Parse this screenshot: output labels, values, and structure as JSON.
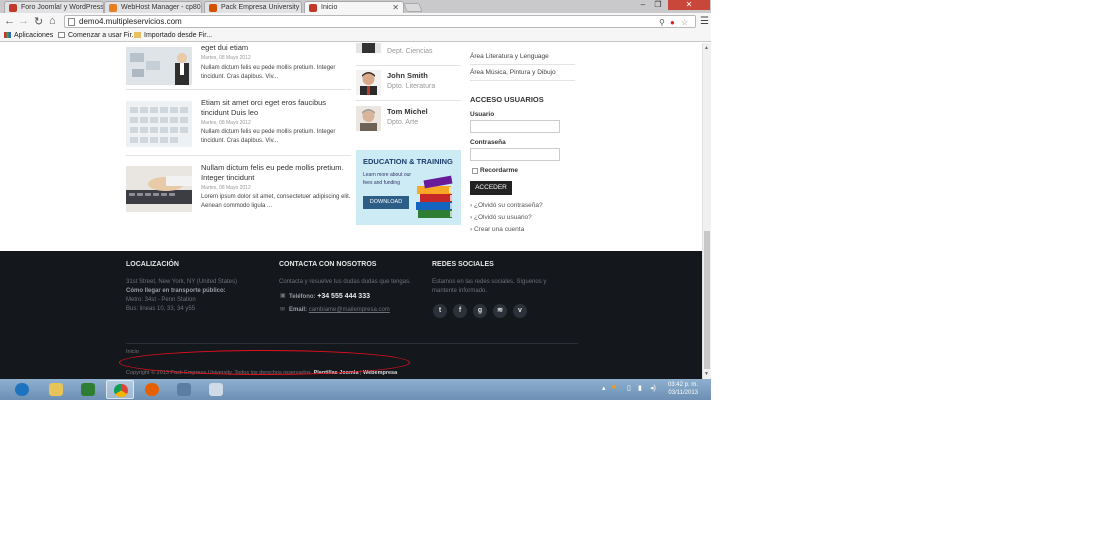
{
  "browser": {
    "tabs": [
      {
        "label": "Foro Joomla! y WordPress",
        "favicon_color": "#c0392b",
        "active": false
      },
      {
        "label": "WebHost Manager - cp80",
        "favicon_color": "#e67e22",
        "active": false
      },
      {
        "label": "Pack Empresa University",
        "favicon_color": "#d35400",
        "active": false
      },
      {
        "label": "Inicio",
        "favicon_color": "#c0392b",
        "active": true
      }
    ],
    "url": "demo4.multipleservicios.com",
    "bookmarks": [
      {
        "label": "Aplicaciones"
      },
      {
        "label": "Comenzar a usar Fir..."
      },
      {
        "label": "Importado desde Fir..."
      }
    ]
  },
  "news": [
    {
      "title": "eget dui etiam",
      "date": "Martes, 08 Mayo 2012",
      "body": "Nullam dictum felis eu pede mollis pretium. Integer tincidunt. Cras dapibus. Viv..."
    },
    {
      "title": "Etiam sit amet orci eget eros faucibus tincidunt Duis leo",
      "date": "Martes, 08 Mayo 2012",
      "body": "Nullam dictum felis eu pede mollis pretium. Integer tincidunt. Cras dapibus. Viv..."
    },
    {
      "title": "Nullam dictum felis eu pede mollis pretium. Integer tincidunt",
      "date": "Martes, 08 Mayo 2012",
      "body": "Lorem ipsum dolor sit amet, consectetuer adipiscing elit. Aenean commodo ligula ..."
    }
  ],
  "staff": [
    {
      "name": "",
      "dept": "Dept. Ciencias"
    },
    {
      "name": "John Smith",
      "dept": "Dpto. Literatura"
    },
    {
      "name": "Tom Michel",
      "dept": "Dpto. Arte"
    }
  ],
  "promo": {
    "title": "EDUCATION & TRAINING",
    "subtitle": "Learn more about our fees and funding",
    "button": "DOWNLOAD"
  },
  "sidebar": {
    "links": [
      "Área Literatura y Lenguage",
      "Área Música, Pintura y Dibujo"
    ],
    "login_title": "ACCESO USUARIOS",
    "user_label": "Usuario",
    "pass_label": "Contraseña",
    "remember_label": "Recordarme",
    "submit_label": "ACCEDER",
    "extra_links": [
      "¿Olvidó su contraseña?",
      "¿Olvidó su usuario?",
      "Crear una cuenta"
    ]
  },
  "footer": {
    "loc_title": "LOCALIZACIÓN",
    "loc_lines": [
      "31st Street, New York, NY (United States)",
      "Cómo llegar en transporte público:",
      "Metro: 34st - Penn Station",
      "Bus: lineas 10, 33, 34 y55"
    ],
    "contact_title": "CONTACTA CON NOSOTROS",
    "contact_intro": "Contacta y resuelve tus dudas dudas que tengas.",
    "phone_label": "Teléfono:",
    "phone": "+34 555 444 333",
    "email_label": "Email:",
    "email": "cambiame@mailempresa.com",
    "social_title": "REDES SOCIALES",
    "social_text": [
      "Estamos en las redes sociales. Síguenos y",
      "mantente informado."
    ],
    "social_icons": [
      {
        "name": "twitter-icon",
        "glyph": "t"
      },
      {
        "name": "facebook-icon",
        "glyph": "f"
      },
      {
        "name": "google-icon",
        "glyph": "g"
      },
      {
        "name": "rss-icon",
        "glyph": "≋"
      },
      {
        "name": "vimeo-icon",
        "glyph": "v"
      }
    ],
    "breadcrumb": "Inicio",
    "copyright": "Copyright © 2013 Pack Empresa University. Todos los derechos reservados.",
    "credit_1": "Plantillas Joomla",
    "credit_sep": "|",
    "credit_2": "Webempresa"
  },
  "taskbar": {
    "time": "03:42 p. m.",
    "date": "03/11/2013",
    "apps": [
      {
        "name": "internet-explorer-icon",
        "color": "#1e73be"
      },
      {
        "name": "file-explorer-icon",
        "color": "#e7c45a"
      },
      {
        "name": "word-icon",
        "color": "#2e7d32"
      },
      {
        "name": "chrome-icon",
        "color": "#db4437"
      },
      {
        "name": "firefox-icon",
        "color": "#e66000"
      },
      {
        "name": "network-icon",
        "color": "#5d7ea3"
      },
      {
        "name": "notepad-icon",
        "color": "#9ab3cf"
      }
    ]
  }
}
